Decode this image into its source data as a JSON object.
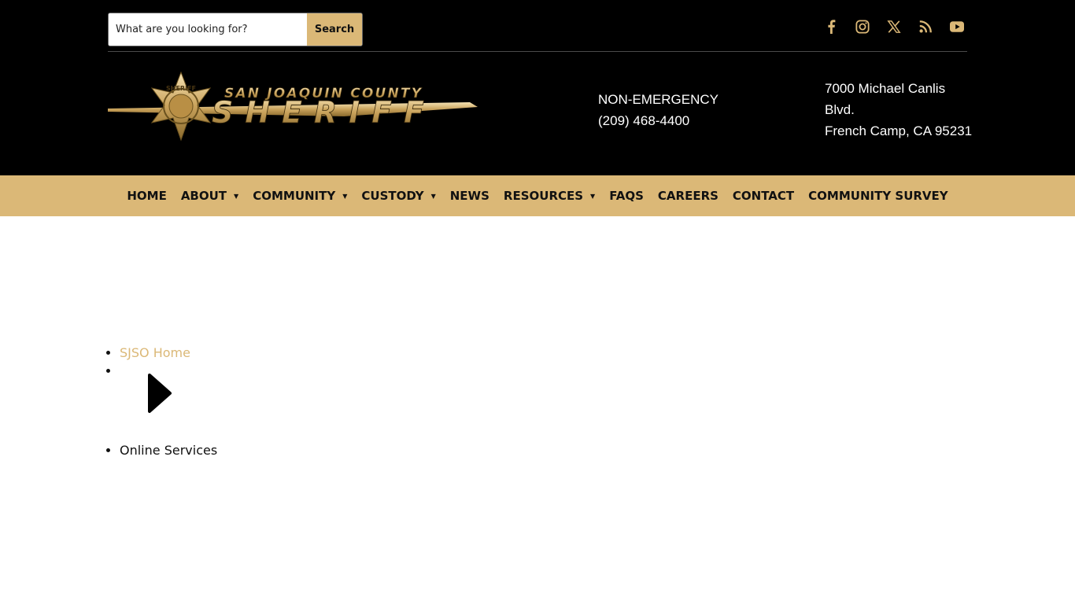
{
  "search": {
    "placeholder": "What are you looking for?",
    "button_label": "Search"
  },
  "social": {
    "icons": [
      "facebook-icon",
      "instagram-icon",
      "x-icon",
      "rss-icon",
      "youtube-icon"
    ],
    "color": "#dbb877"
  },
  "logo": {
    "line1": "SAN JOAQUIN COUNTY",
    "line2": "SHERIFF",
    "badge": "SHERIFF"
  },
  "contact": {
    "label": "NON-EMERGENCY",
    "phone": "(209) 468-4400",
    "address_line1": "7000 Michael Canlis",
    "address_line2": "Blvd.",
    "address_line3": "French Camp, CA 95231"
  },
  "nav": {
    "items": [
      {
        "label": "HOME",
        "dropdown": false
      },
      {
        "label": "ABOUT",
        "dropdown": true
      },
      {
        "label": "COMMUNITY",
        "dropdown": true
      },
      {
        "label": "CUSTODY",
        "dropdown": true
      },
      {
        "label": "NEWS",
        "dropdown": false
      },
      {
        "label": "RESOURCES",
        "dropdown": true
      },
      {
        "label": "FAQS",
        "dropdown": false
      },
      {
        "label": "CAREERS",
        "dropdown": false
      },
      {
        "label": "CONTACT",
        "dropdown": false
      },
      {
        "label": "COMMUNITY SURVEY",
        "dropdown": false
      }
    ]
  },
  "breadcrumb": {
    "home_label": "SJSO Home",
    "current_label": "Online Services"
  },
  "colors": {
    "accent": "#dbb877",
    "header_bg": "#000000",
    "text": "#111111"
  }
}
